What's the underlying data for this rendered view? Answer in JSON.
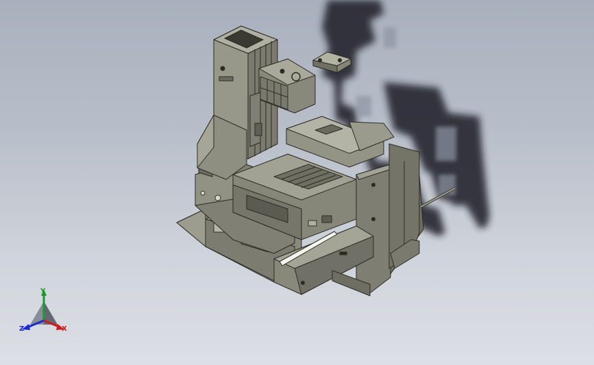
{
  "viewport": {
    "background_top": "#a9b0bd",
    "background_bottom": "#dcdfe5",
    "model_color": "#8d8d80",
    "shadow_color": "#1a1c22"
  },
  "triad": {
    "x_label": "X",
    "y_label": "Y",
    "z_label": "Z",
    "x_color": "#d11a1a",
    "y_color": "#1a9a2a",
    "z_color": "#1a2ad1"
  }
}
